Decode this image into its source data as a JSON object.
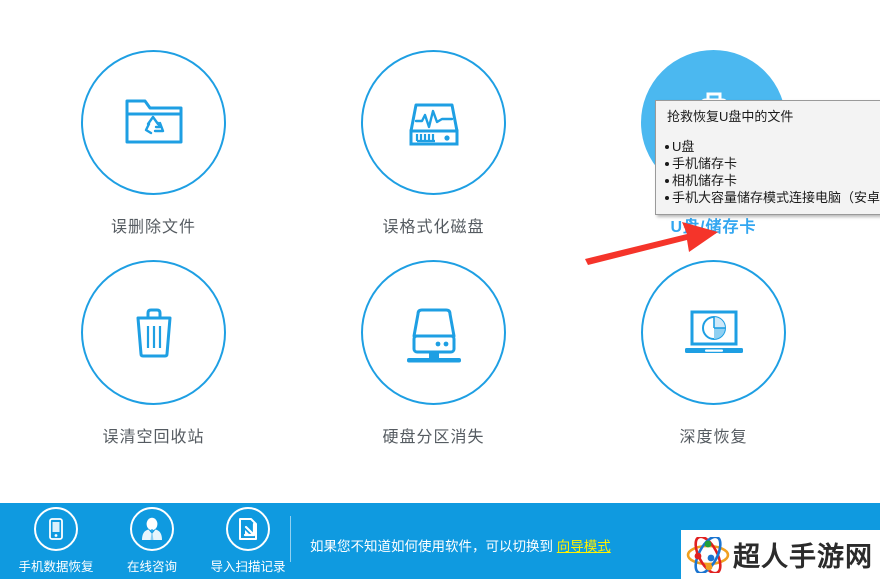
{
  "theme": {
    "accent": "#1e9fe3",
    "footer_bg": "#0f9ae0",
    "active_circle": "#4bb8f0",
    "highlight_text": "#32a6f0",
    "link_color": "#fff000",
    "arrow_color": "#f5342a",
    "label_color": "#555b61"
  },
  "main": {
    "options": [
      {
        "id": "deleted-files",
        "label": "误删除文件",
        "icon": "folder-recycle-icon",
        "active": false,
        "highlight": false
      },
      {
        "id": "formatted-disk",
        "label": "误格式化磁盘",
        "icon": "disk-pulse-icon",
        "active": false,
        "highlight": false
      },
      {
        "id": "usb-memory-card",
        "label": "U盘/储存卡",
        "icon": "usb-card-icon",
        "active": true,
        "highlight": true
      },
      {
        "id": "emptied-recycle",
        "label": "误清空回收站",
        "icon": "trash-bin-icon",
        "active": false,
        "highlight": false
      },
      {
        "id": "lost-partition",
        "label": "硬盘分区消失",
        "icon": "external-hdd-icon",
        "active": false,
        "highlight": false
      },
      {
        "id": "deep-recovery",
        "label": "深度恢复",
        "icon": "laptop-pie-icon",
        "active": false,
        "highlight": false
      }
    ]
  },
  "tooltip": {
    "title": "抢救恢复U盘中的文件",
    "items": [
      "U盘",
      "手机储存卡",
      "相机储存卡",
      "手机大容量储存模式连接电脑（安卓）"
    ]
  },
  "footer": {
    "items": [
      {
        "id": "phone-data-recovery",
        "label": "手机数据恢复",
        "icon": "mobile-phone-icon"
      },
      {
        "id": "online-consult",
        "label": "在线咨询",
        "icon": "person-avatar-icon"
      },
      {
        "id": "import-scan-record",
        "label": "导入扫描记录",
        "icon": "import-arrow-icon"
      }
    ],
    "hint_prefix": "如果您不知道如何使用软件，可以切换到 ",
    "hint_link": "向导模式"
  },
  "watermark": {
    "text": "超人手游网"
  }
}
